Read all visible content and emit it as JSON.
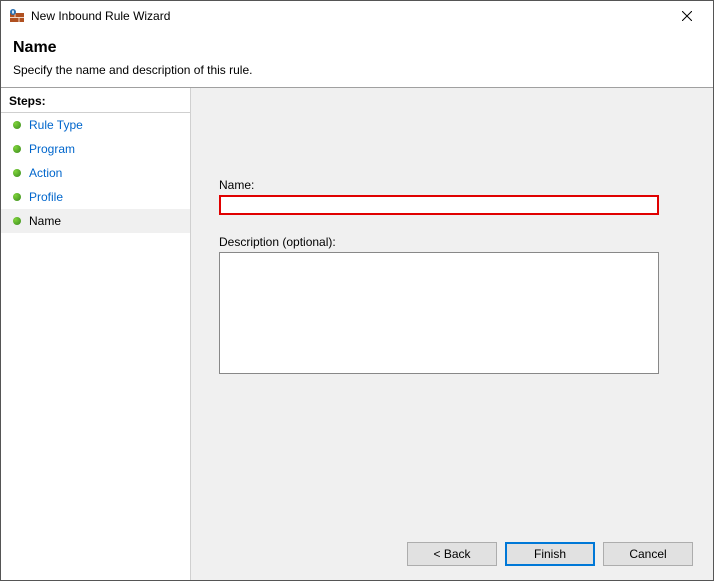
{
  "titlebar": {
    "title": "New Inbound Rule Wizard"
  },
  "header": {
    "title": "Name",
    "subtitle": "Specify the name and description of this rule."
  },
  "sidebar": {
    "header": "Steps:",
    "items": [
      {
        "label": "Rule Type"
      },
      {
        "label": "Program"
      },
      {
        "label": "Action"
      },
      {
        "label": "Profile"
      },
      {
        "label": "Name"
      }
    ]
  },
  "form": {
    "name_label": "Name:",
    "name_value": "",
    "desc_label": "Description (optional):",
    "desc_value": ""
  },
  "buttons": {
    "back": "< Back",
    "finish": "Finish",
    "cancel": "Cancel"
  }
}
